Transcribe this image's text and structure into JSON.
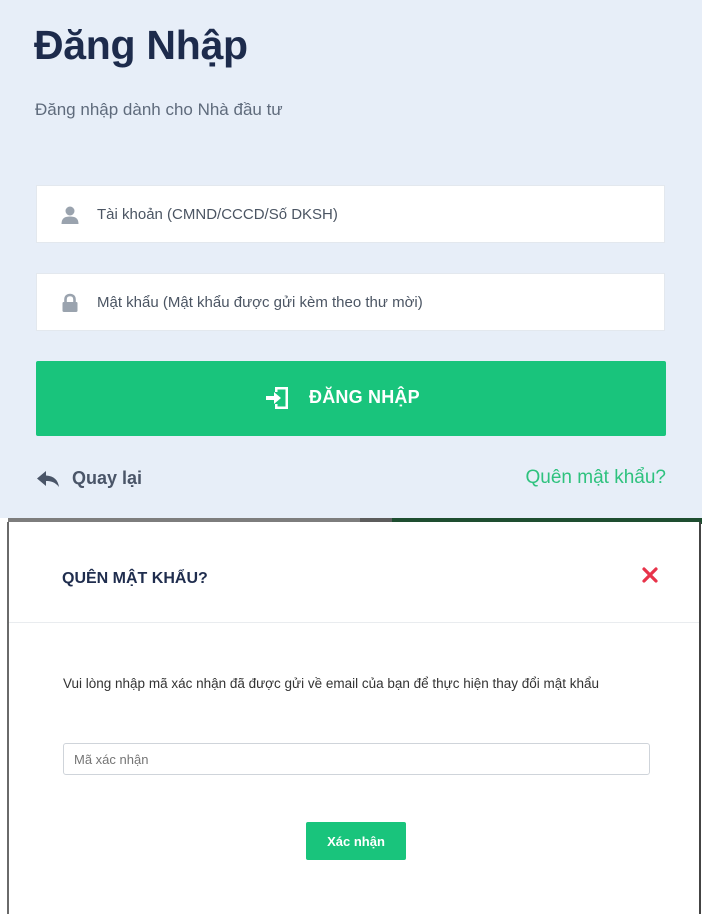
{
  "login": {
    "title": "Đăng Nhập",
    "subtitle": "Đăng nhập dành cho Nhà đầu tư",
    "account_field": {
      "placeholder": "Tài khoản (CMND/CCCD/Số DKSH)",
      "icon": "user-icon"
    },
    "password_field": {
      "placeholder": "Mật khẩu (Mật khẩu được gửi kèm theo thư mời)",
      "icon": "lock-icon"
    },
    "submit_label": "ĐĂNG NHẬP",
    "submit_icon": "sign-in-icon",
    "back_label": "Quay lại",
    "back_icon": "reply-arrow-icon",
    "forgot_label": "Quên mật khẩu?"
  },
  "modal": {
    "title": "QUÊN MẬT KHẨU?",
    "close_icon": "close-icon",
    "message": "Vui lòng nhập mã xác nhận đã được gửi về email của bạn để thực hiện thay đổi mật khẩu",
    "code_placeholder": "Mã xác nhận",
    "confirm_label": "Xác nhận"
  },
  "colors": {
    "panel_background": "#e7eef8",
    "primary_green": "#19c47c",
    "link_green": "#2ec27e",
    "title_navy": "#1d2b4c",
    "close_red": "#e8334a"
  }
}
